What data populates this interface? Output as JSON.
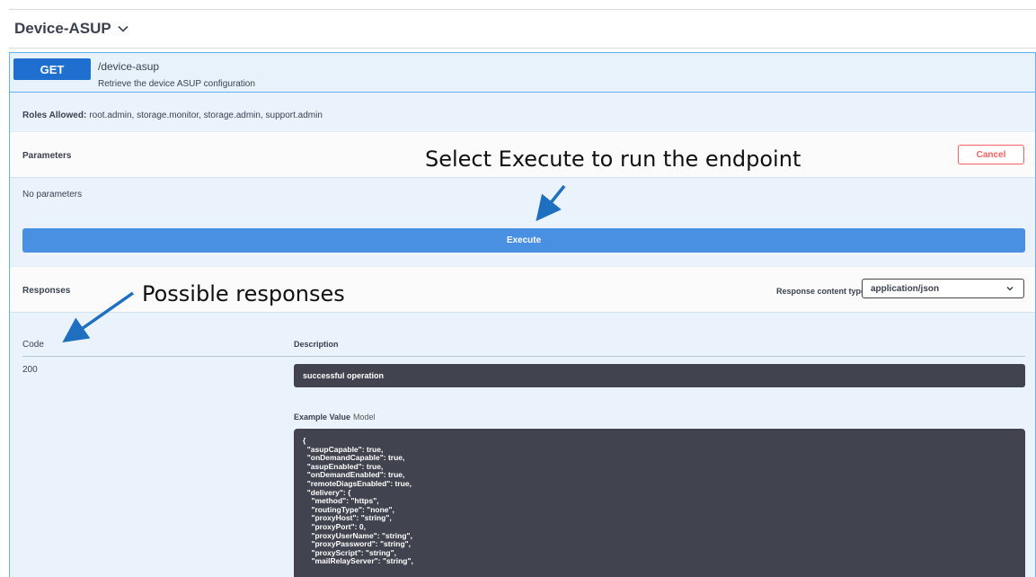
{
  "section": {
    "title": "Device-ASUP"
  },
  "operation": {
    "method": "GET",
    "path": "/device-asup",
    "description": "Retrieve the device ASUP configuration",
    "roles_label": "Roles Allowed:",
    "roles_value": "root.admin, storage.monitor, storage.admin, support.admin"
  },
  "parameters": {
    "label": "Parameters",
    "cancel_label": "Cancel",
    "empty_text": "No parameters",
    "execute_label": "Execute"
  },
  "responses": {
    "label": "Responses",
    "content_type_label": "Response content type",
    "content_type_value": "application/json",
    "col_code": "Code",
    "col_description": "Description",
    "rows": [
      {
        "code": "200",
        "description": "successful operation"
      }
    ],
    "example_label": "Example Value",
    "model_label": "Model",
    "example_json": "{\n  \"asupCapable\": true,\n  \"onDemandCapable\": true,\n  \"asupEnabled\": true,\n  \"onDemandEnabled\": true,\n  \"remoteDiagsEnabled\": true,\n  \"delivery\": {\n    \"method\": \"https\",\n    \"routingType\": \"none\",\n    \"proxyHost\": \"string\",\n    \"proxyPort\": 0,\n    \"proxyUserName\": \"string\",\n    \"proxyPassword\": \"string\",\n    \"proxyScript\": \"string\",\n    \"mailRelayServer\": \"string\","
  },
  "annotations": {
    "execute_callout": "Select Execute to run the endpoint",
    "responses_callout": "Possible responses",
    "arrow_color": "#1e6fc0"
  }
}
